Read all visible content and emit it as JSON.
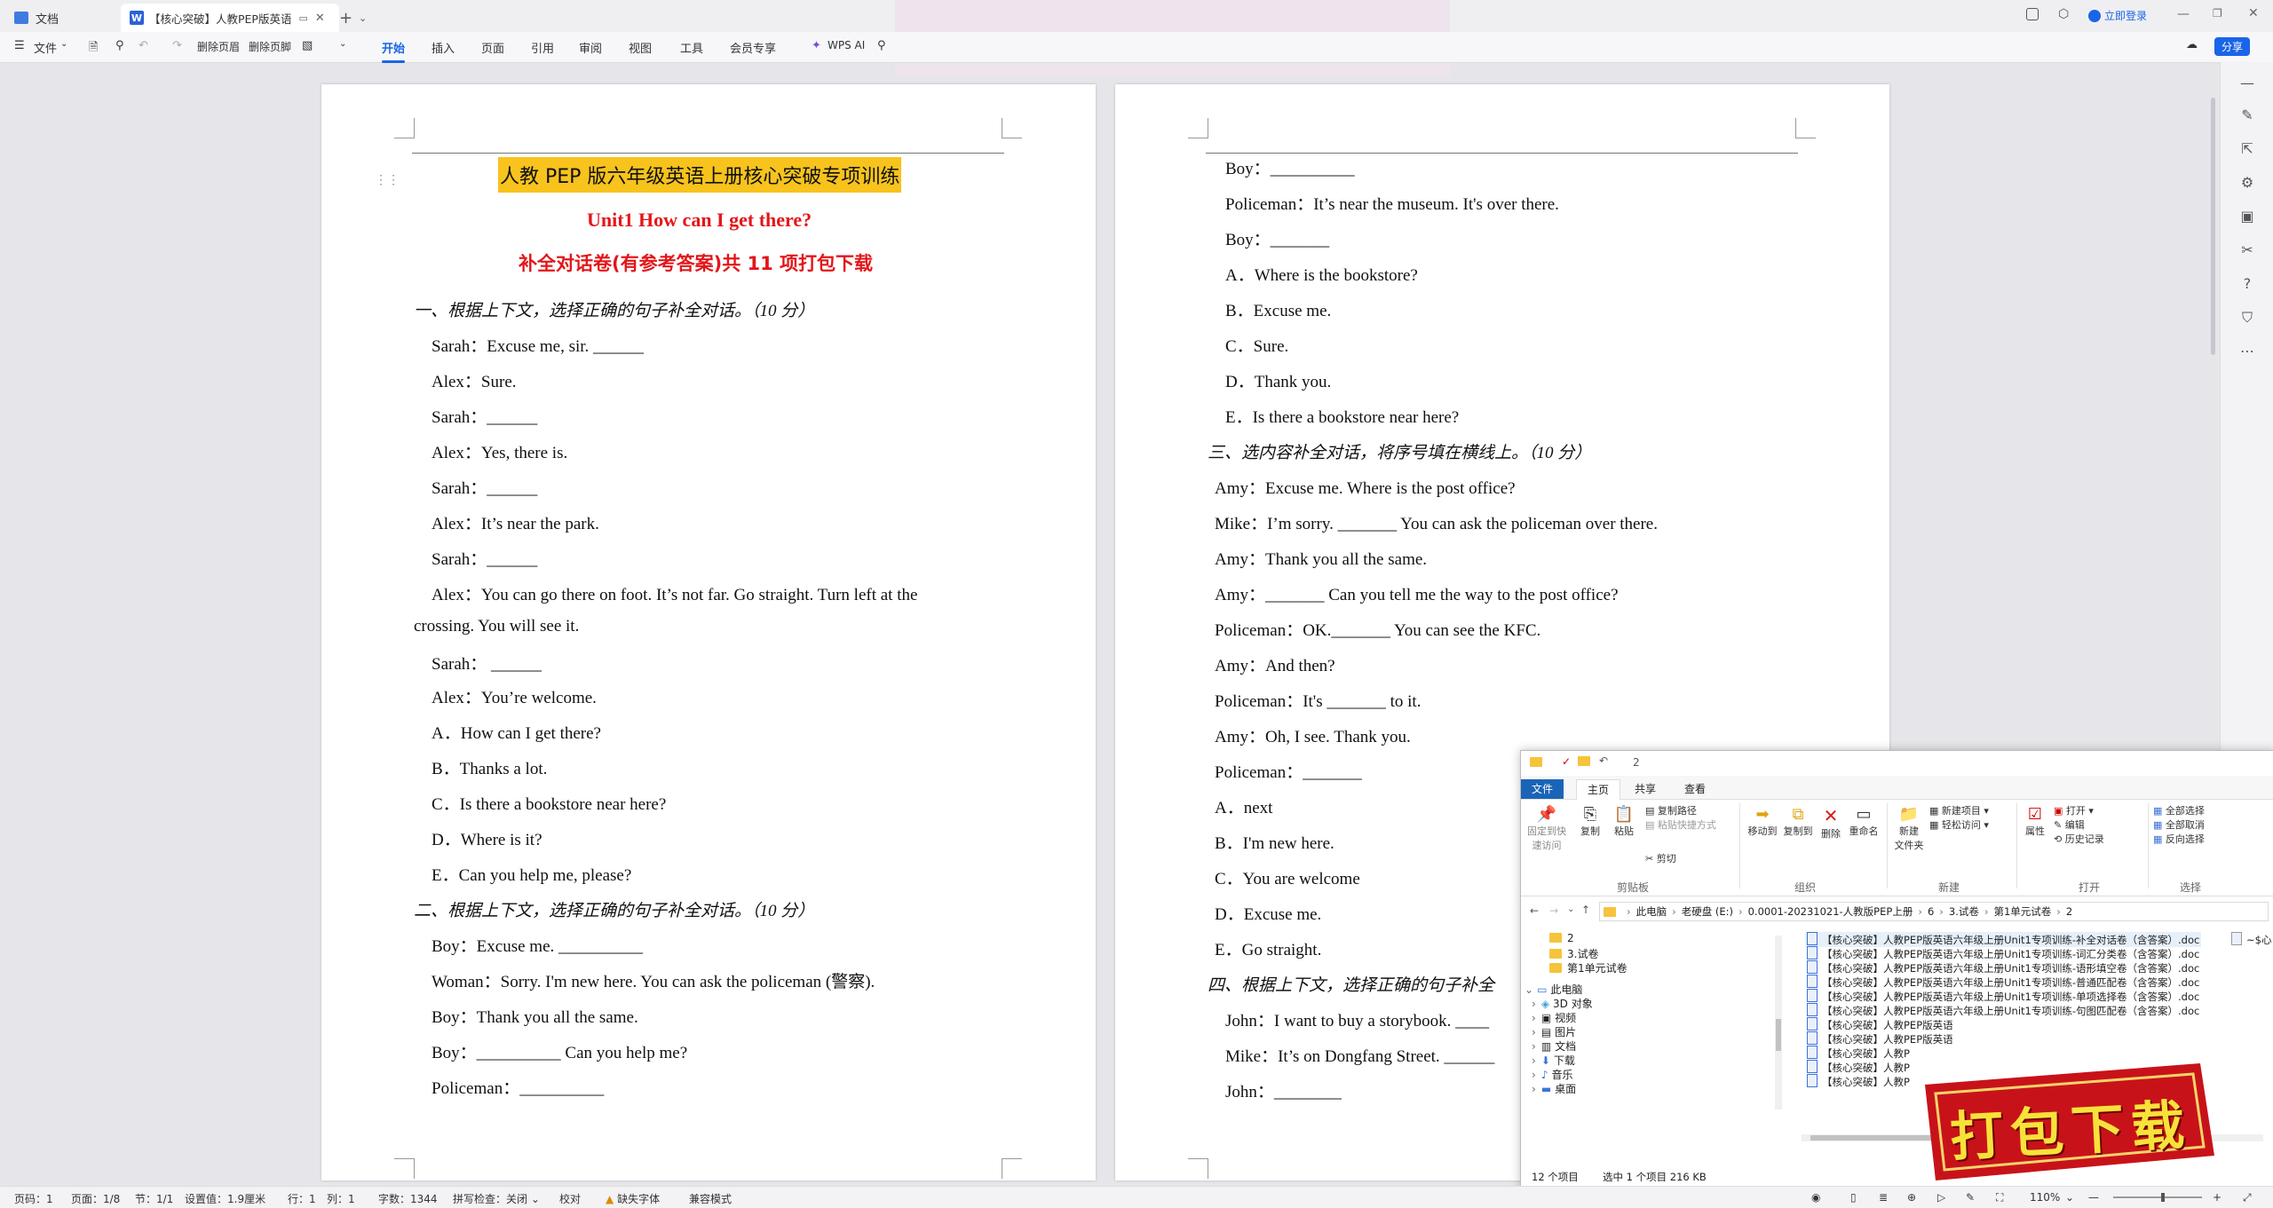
{
  "titlebar": {
    "home_tab": "文档",
    "doc_tab": "【核心突破】人教PEP版英语",
    "login": "立即登录"
  },
  "ribbon": {
    "file_menu": "文件",
    "delete_header": "删除页眉",
    "delete_footer": "删除页脚",
    "tabs": [
      "开始",
      "插入",
      "页面",
      "引用",
      "审阅",
      "视图",
      "工具",
      "会员专享"
    ],
    "wps_ai": "WPS AI",
    "share": "分享"
  },
  "page1": {
    "title": "人教 PEP 版六年级英语上册核心突破专项训练",
    "unit": "Unit1 How can I get there?",
    "subtitle": "补全对话卷(有参考答案)共 11 项打包下载",
    "sec1": "一、根据上下文，选择正确的句子补全对话。（10 分）",
    "l1": "Sarah：Excuse me, sir. ______",
    "l2": "Alex：Sure.",
    "l3": "Sarah：______",
    "l4": "Alex：Yes, there is.",
    "l5": "Sarah：______",
    "l6": "Alex：It’s near the park.",
    "l7": "Sarah：______",
    "l8": "Alex：You can go there on foot. It’s not far. Go straight. Turn left at the",
    "l9": "crossing. You will see it.",
    "l10": "Sarah：  ______",
    "l11": "Alex：You’re welcome.",
    "o1": "A．How can I get there?",
    "o2": "B．Thanks a lot.",
    "o3": "C．Is there a bookstore near here?",
    "o4": "D．Where is it?",
    "o5": "E．Can you help me, please?",
    "sec2": "二、根据上下文，选择正确的句子补全对话。（10 分）",
    "m1": "Boy：Excuse me. __________",
    "m2": "Woman：Sorry. I'm new here. You can ask the policeman (警察).",
    "m3": "Boy：Thank you all the same.",
    "m4": "Boy：__________ Can you help me?",
    "m5": "Policeman：__________"
  },
  "page2": {
    "n1": "Boy：__________",
    "n2": "Policeman：It’s near the museum. It's over there.",
    "n3": "Boy：_______",
    "p1": "A．Where is the bookstore?",
    "p2": "B．Excuse me.",
    "p3": "C．Sure.",
    "p4": "D．Thank you.",
    "p5": "E．Is there a bookstore near here?",
    "sec3": "三、选内容补全对话，将序号填在横线上。（10 分）",
    "q1": "Amy：Excuse me. Where is the post office?",
    "q2": "Mike：I’m sorry. _______ You can ask the policeman over there.",
    "q3": "Amy：Thank you all the same.",
    "q4": "Amy：_______ Can you tell me the way to the post office?",
    "q5": "Policeman：OK._______ You can see the KFC.",
    "q6": "Amy：And then?",
    "q7": "Policeman：It's _______ to it.",
    "q8": "Amy：Oh, I see. Thank you.",
    "q9": "Policeman：_______",
    "r1": "A．next",
    "r2": "B．I'm new here.",
    "r3": "C．You are welcome",
    "r4": "D．Excuse me.",
    "r5": "E．Go straight.",
    "sec4": "四、根据上下文，选择正确的句子补全",
    "s1": "John：I want to buy a storybook. ____",
    "s2": "Mike：It’s on Dongfang Street. ______",
    "s3": "John：________"
  },
  "explorer": {
    "title_num": "2",
    "tabs": [
      "文件",
      "主页",
      "共享",
      "查看"
    ],
    "btn_pin": "固定到快\n速访问",
    "btn_copy": "复制",
    "btn_paste": "粘贴",
    "btn_copypath": "复制路径",
    "btn_pasteshortcut": "粘贴快捷方式",
    "btn_cut": "剪切",
    "btn_moveto": "移动到",
    "btn_copyto": "复制到",
    "btn_delete": "删除",
    "btn_rename": "重命名",
    "btn_newfolder": "新建\n文件夹",
    "btn_newitem": "新建项目",
    "btn_easyaccess": "轻松访问",
    "btn_properties": "属性",
    "btn_open": "打开",
    "btn_edit": "编辑",
    "btn_history": "历史记录",
    "btn_selectall": "全部选择",
    "btn_selectnone": "全部取消",
    "btn_invert": "反向选择",
    "grp_clipboard": "剪贴板",
    "grp_organize": "组织",
    "grp_new": "新建",
    "grp_open": "打开",
    "grp_select": "选择",
    "path": [
      "此电脑",
      "老硬盘 (E:)",
      "0.0001-20231021-人教版PEP上册",
      "6",
      "3.试卷",
      "第1单元试卷",
      "2"
    ],
    "tree": [
      "2",
      "3.试卷",
      "第1单元试卷",
      "此电脑",
      "3D 对象",
      "视频",
      "图片",
      "文档",
      "下载",
      "音乐",
      "桌面"
    ],
    "files": [
      "【核心突破】人教PEP版英语六年级上册Unit1专项训练-补全对话卷（含答案）.doc",
      "【核心突破】人教PEP版英语六年级上册Unit1专项训练-词汇分类卷（含答案）.doc",
      "【核心突破】人教PEP版英语六年级上册Unit1专项训练-语形填空卷（含答案）.doc",
      "【核心突破】人教PEP版英语六年级上册Unit1专项训练-普通匹配卷（含答案）.doc",
      "【核心突破】人教PEP版英语六年级上册Unit1专项训练-单项选择卷（含答案）.doc",
      "【核心突破】人教PEP版英语六年级上册Unit1专项训练-句图匹配卷（含答案）.doc",
      "【核心突破】人教PEP版英语",
      "【核心突破】人教PEP版英语",
      "【核心突破】人教P",
      "【核心突破】人教P",
      "【核心突破】人教P"
    ],
    "side_file": "~$心",
    "status_count": "12 个项目",
    "status_selected": "选中 1 个项目  216 KB"
  },
  "promo": {
    "text": "打包下载"
  },
  "statusbar": {
    "page_no": "页码：1",
    "page_of": "页面：1/8",
    "section": "节：1/1",
    "setting": "设置值：1.9厘米",
    "row": "行：1",
    "col": "列：1",
    "words": "字数：1344",
    "spell": "拼写检查：关闭",
    "proof": "校对",
    "missing_font": "缺失字体",
    "compat": "兼容模式",
    "zoom": "110%"
  },
  "colors": {
    "accent": "#1a64e8",
    "title_highlight": "#f7c31c",
    "red": "#e3161a"
  }
}
